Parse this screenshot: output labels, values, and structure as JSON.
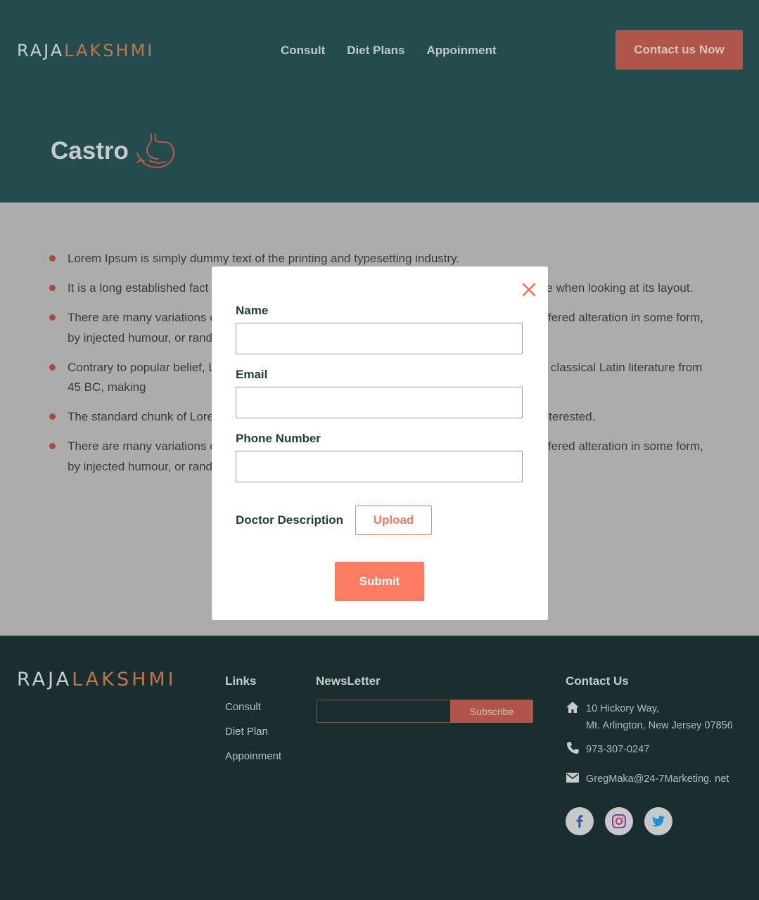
{
  "header": {
    "logo_part1": "RAJA",
    "logo_part2": "LAKSHMI",
    "nav": [
      "Consult",
      "Diet Plans",
      "Appoinment"
    ],
    "contact_button": "Contact us Now",
    "page_title": "Castro",
    "title_icon": "stomach-icon"
  },
  "content": {
    "bullets": [
      "Lorem Ipsum is simply dummy text of the printing and typesetting industry.",
      "It is a long established fact that a reader will be distracted by the readable content of a page when looking at its layout.",
      "There are many variations of passages of Lorem Ipsum available, but the majority have suffered alteration in some form, by injected humour, or randomised words.",
      "Contrary to popular belief, Lorem Ipsum is not simply random text. It has roots in a piece of classical Latin literature from 45 BC, making",
      "The standard chunk of Lorem Ipsum used since the 1500s is reproduced below for those interested.",
      "There are many variations of passages of Lorem Ipsum available, but the majority have suffered alteration in some form, by injected humour, or randomised words which don't look even slightly believable."
    ]
  },
  "modal": {
    "name_label": "Name",
    "name_value": "",
    "email_label": "Email",
    "email_value": "",
    "phone_label": "Phone Number",
    "phone_value": "",
    "upload_label": "Doctor Description",
    "upload_button": "Upload",
    "submit_button": "Submit"
  },
  "footer": {
    "logo_part1": "RAJA",
    "logo_part2": "LAKSHMI",
    "links_title": "Links",
    "links": [
      "Consult",
      "Diet Plan",
      "Appoinment"
    ],
    "newsletter_title": "NewsLetter",
    "newsletter_value": "",
    "subscribe_button": "Subscribe",
    "contact_title": "Contact Us",
    "address_line1": "10 Hickory Way,",
    "address_line2": "Mt. Arlington, New Jersey 07856",
    "phone": "973-307-0247",
    "email": "GregMaka@24-7Marketing. net",
    "social": [
      "facebook-icon",
      "instagram-icon",
      "twitter-icon"
    ]
  },
  "colors": {
    "header_bg": "#244b4d",
    "footer_bg": "#1a2e30",
    "accent": "#fc7b63",
    "overlay_content_bg": "#acacac"
  }
}
